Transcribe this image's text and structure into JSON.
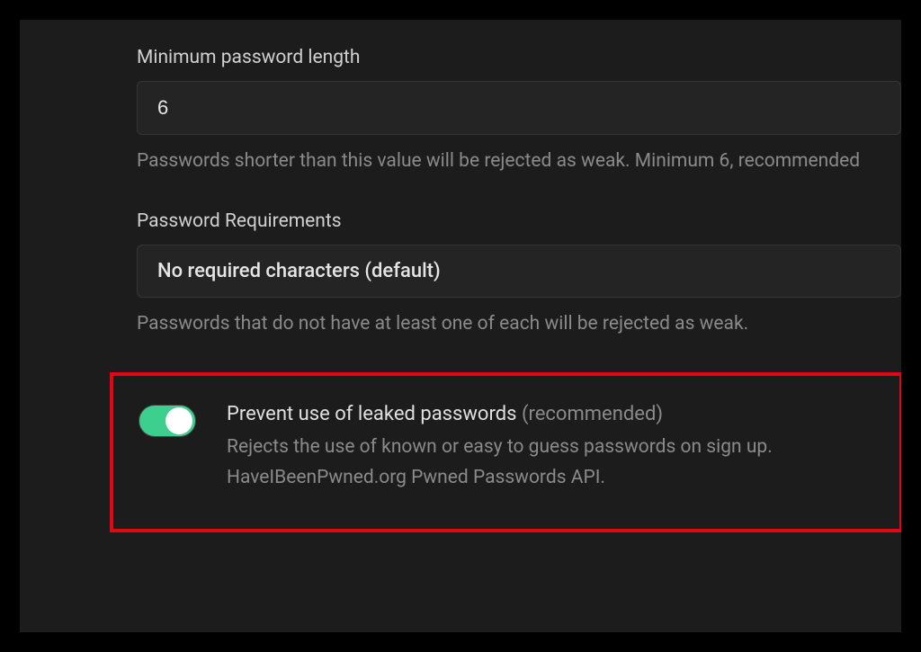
{
  "minLength": {
    "label": "Minimum password length",
    "value": "6",
    "helper": "Passwords shorter than this value will be rejected as weak. Minimum 6, recommended"
  },
  "requirements": {
    "label": "Password Requirements",
    "selected": "No required characters (default)",
    "helper": "Passwords that do not have at least one of each will be rejected as weak."
  },
  "leakedPasswords": {
    "title": "Prevent use of leaked passwords",
    "titleSuffix": "(recommended)",
    "description": "Rejects the use of known or easy to guess passwords on sign up. HaveIBeenPwned.org Pwned Passwords API.",
    "enabled": true
  }
}
